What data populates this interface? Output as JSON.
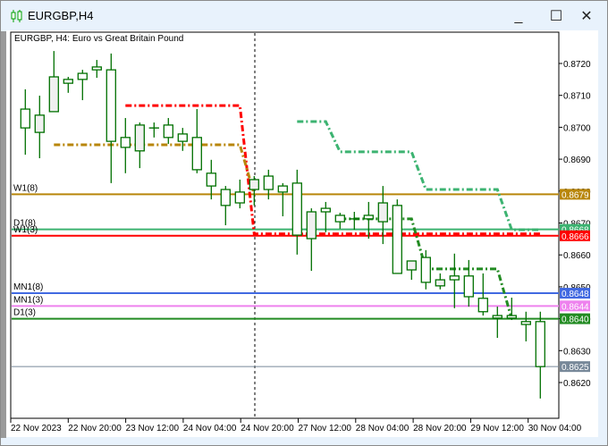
{
  "window": {
    "title": "EURGBP,H4",
    "icon": "candlestick-chart-icon",
    "buttons": {
      "minimize": "_",
      "maximize": "☐",
      "close": "✕"
    }
  },
  "chart": {
    "header": "EURGBP, H4:  Euro vs Great Britain Pound",
    "symbol": "EURGBP",
    "timeframe": "H4",
    "candle_colors": {
      "outline": "#007000",
      "bull_fill": "#f0f0f0",
      "bear_fill": "#ffffff"
    },
    "price_axis": {
      "ticks": [
        "0.8720",
        "0.8710",
        "0.8700",
        "0.8690",
        "0.8680",
        "0.8670",
        "0.8660",
        "0.8650",
        "0.8640",
        "0.8630",
        "0.8620"
      ]
    },
    "time_axis": {
      "labels": [
        "22 Nov 2023",
        "22 Nov 20:00",
        "23 Nov 12:00",
        "24 Nov 04:00",
        "24 Nov 20:00",
        "27 Nov 12:00",
        "28 Nov 04:00",
        "28 Nov 20:00",
        "29 Nov 12:00",
        "30 Nov 04:00"
      ]
    },
    "candles": [
      {
        "o": 0.87068,
        "h": 0.87082,
        "l": 0.8704,
        "c": 0.87049
      },
      {
        "o": 0.87057,
        "h": 0.87119,
        "l": 0.86914,
        "c": 0.86998
      },
      {
        "o": 0.86984,
        "h": 0.87099,
        "l": 0.86903,
        "c": 0.87038
      },
      {
        "o": 0.87049,
        "h": 0.87239,
        "l": 0.87049,
        "c": 0.87158
      },
      {
        "o": 0.8715,
        "h": 0.87158,
        "l": 0.87108,
        "c": 0.87138
      },
      {
        "o": 0.87169,
        "h": 0.8718,
        "l": 0.87085,
        "c": 0.8715
      },
      {
        "o": 0.87189,
        "h": 0.87211,
        "l": 0.87155,
        "c": 0.8718
      },
      {
        "o": 0.8718,
        "h": 0.87231,
        "l": 0.86825,
        "c": 0.86956
      },
      {
        "o": 0.86968,
        "h": 0.87029,
        "l": 0.86856,
        "c": 0.86937
      },
      {
        "o": 0.86926,
        "h": 0.87015,
        "l": 0.86872,
        "c": 0.87007
      },
      {
        "o": 0.86998,
        "h": 0.87015,
        "l": 0.86968,
        "c": 0.86998
      },
      {
        "o": 0.87007,
        "h": 0.87029,
        "l": 0.86948,
        "c": 0.86968
      },
      {
        "o": 0.86979,
        "h": 0.86998,
        "l": 0.86926,
        "c": 0.86956
      },
      {
        "o": 0.86968,
        "h": 0.87057,
        "l": 0.86856,
        "c": 0.86867
      },
      {
        "o": 0.86856,
        "h": 0.86898,
        "l": 0.86774,
        "c": 0.86816
      },
      {
        "o": 0.86805,
        "h": 0.86816,
        "l": 0.86693,
        "c": 0.86755
      },
      {
        "o": 0.86797,
        "h": 0.86836,
        "l": 0.86746,
        "c": 0.86763
      },
      {
        "o": 0.86805,
        "h": 0.86847,
        "l": 0.86755,
        "c": 0.86836
      },
      {
        "o": 0.86847,
        "h": 0.86867,
        "l": 0.86774,
        "c": 0.86805
      },
      {
        "o": 0.86816,
        "h": 0.86825,
        "l": 0.86721,
        "c": 0.86797
      },
      {
        "o": 0.86825,
        "h": 0.86867,
        "l": 0.86601,
        "c": 0.86662
      },
      {
        "o": 0.86651,
        "h": 0.86746,
        "l": 0.8655,
        "c": 0.86735
      },
      {
        "o": 0.86746,
        "h": 0.86766,
        "l": 0.86671,
        "c": 0.86735
      },
      {
        "o": 0.86724,
        "h": 0.86732,
        "l": 0.86682,
        "c": 0.86704
      },
      {
        "o": 0.86713,
        "h": 0.86735,
        "l": 0.86679,
        "c": 0.86713
      },
      {
        "o": 0.86724,
        "h": 0.86766,
        "l": 0.86651,
        "c": 0.86713
      },
      {
        "o": 0.86704,
        "h": 0.86816,
        "l": 0.86634,
        "c": 0.86763
      },
      {
        "o": 0.86755,
        "h": 0.86774,
        "l": 0.86542,
        "c": 0.86542
      },
      {
        "o": 0.86553,
        "h": 0.86581,
        "l": 0.86522,
        "c": 0.86581
      },
      {
        "o": 0.86592,
        "h": 0.86615,
        "l": 0.86492,
        "c": 0.86514
      },
      {
        "o": 0.86503,
        "h": 0.86542,
        "l": 0.86492,
        "c": 0.86522
      },
      {
        "o": 0.86534,
        "h": 0.86604,
        "l": 0.86433,
        "c": 0.86522
      },
      {
        "o": 0.86534,
        "h": 0.86584,
        "l": 0.86438,
        "c": 0.86469
      },
      {
        "o": 0.86464,
        "h": 0.86542,
        "l": 0.8641,
        "c": 0.86422
      },
      {
        "o": 0.8641,
        "h": 0.86438,
        "l": 0.8634,
        "c": 0.86402
      },
      {
        "o": 0.8641,
        "h": 0.86466,
        "l": 0.86396,
        "c": 0.86402
      },
      {
        "o": 0.86391,
        "h": 0.86422,
        "l": 0.86329,
        "c": 0.86382
      },
      {
        "o": 0.86391,
        "h": 0.86422,
        "l": 0.8615,
        "c": 0.8625
      }
    ],
    "levels": [
      {
        "name": "W1(8)",
        "price": 0.8679,
        "label": "0.8679",
        "color": "#b8860b"
      },
      {
        "name": "D1(8)",
        "price": 0.8668,
        "label": "0.8668",
        "color": "#3cb371"
      },
      {
        "name": "W1(3)",
        "price": 0.8666,
        "label": "0.8666",
        "color": "#ff0000"
      },
      {
        "name": "MN1(8)",
        "price": 0.8648,
        "label": "0.8648",
        "color": "#4169e1"
      },
      {
        "name": "MN1(3)",
        "price": 0.8644,
        "label": "0.8644",
        "color": "#ee82ee"
      },
      {
        "name": "D1(3)",
        "price": 0.864,
        "label": "0.8640",
        "color": "#228b22"
      }
    ],
    "bid_line": {
      "price": 0.8625,
      "label": "0.8625",
      "color": "#778899"
    },
    "step_lines": [
      {
        "color": "#ff0000",
        "points": [
          [
            8,
            0.87068
          ],
          [
            16,
            0.87068
          ],
          [
            17,
            0.86666
          ],
          [
            37,
            0.86666
          ]
        ]
      },
      {
        "color": "#b8860b",
        "points": [
          [
            3,
            0.86945
          ],
          [
            16,
            0.86945
          ],
          [
            17,
            0.8679
          ]
        ]
      },
      {
        "color": "#3cb371",
        "points": [
          [
            20,
            0.87018
          ],
          [
            22,
            0.87018
          ],
          [
            23,
            0.86923
          ],
          [
            28,
            0.86923
          ],
          [
            29,
            0.86805
          ],
          [
            34,
            0.86805
          ],
          [
            35,
            0.86679
          ],
          [
            37,
            0.86679
          ]
        ]
      },
      {
        "color": "#228b22",
        "points": [
          [
            23,
            0.86713
          ],
          [
            28,
            0.86713
          ],
          [
            29,
            0.86556
          ],
          [
            34,
            0.86556
          ],
          [
            35,
            0.864
          ]
        ]
      }
    ]
  }
}
